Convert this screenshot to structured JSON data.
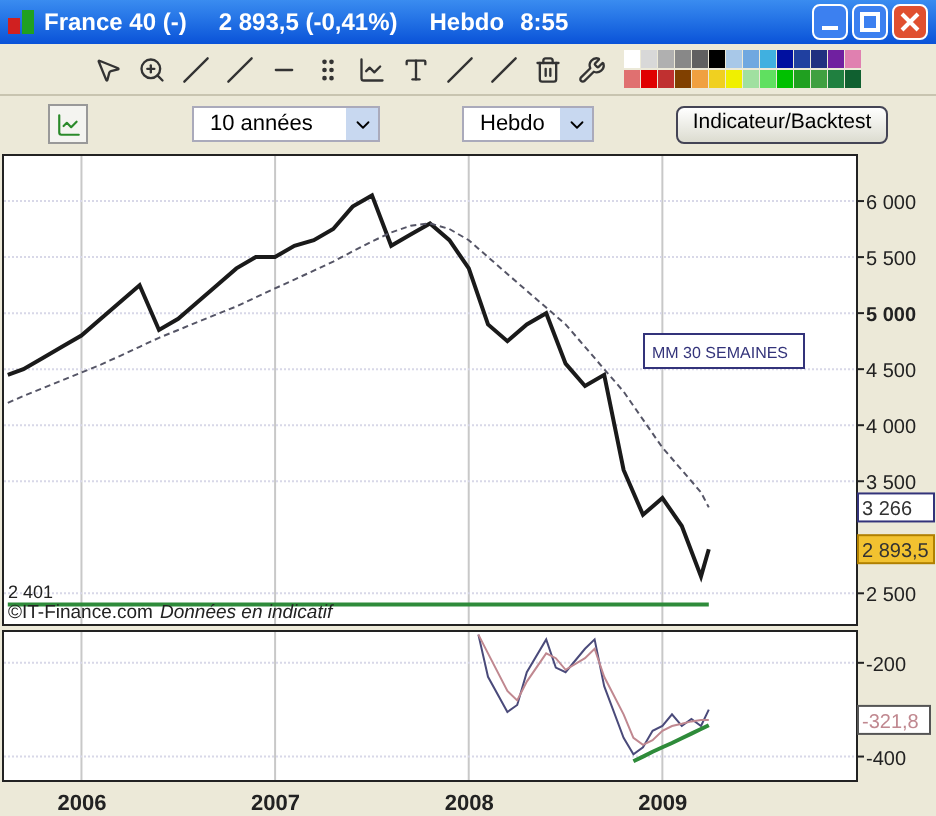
{
  "window": {
    "title_name": "France 40 (-)",
    "title_price": "2 893,5 (-0,41%)",
    "title_period": "Hebdo",
    "title_time": "8:55"
  },
  "toolbar2": {
    "range_select": "10 années",
    "period_select": "Hebdo",
    "indicator_button": "Indicateur/Backtest"
  },
  "price_chart": {
    "source": "©IT-Finance.com",
    "disclaimer": "Données en indicatif",
    "level_label": "2 401",
    "value_tags": [
      {
        "text": "3 266",
        "color": "#ffffff"
      },
      {
        "text": "2 893,5",
        "color": "#f2c230"
      }
    ],
    "chart_data": {
      "type": "line",
      "grid": true,
      "x": [
        2005.62,
        2005.7,
        2005.8,
        2005.9,
        2006.0,
        2006.1,
        2006.2,
        2006.3,
        2006.4,
        2006.5,
        2006.6,
        2006.7,
        2006.8,
        2006.9,
        2007.0,
        2007.1,
        2007.2,
        2007.3,
        2007.4,
        2007.5,
        2007.6,
        2007.7,
        2007.8,
        2007.9,
        2008.0,
        2008.1,
        2008.2,
        2008.3,
        2008.4,
        2008.5,
        2008.6,
        2008.7,
        2008.8,
        2008.9,
        2009.0,
        2009.1,
        2009.2,
        2009.24
      ],
      "series": [
        {
          "color": "#1a1a1a",
          "values": [
            4450,
            4500,
            4600,
            4700,
            4800,
            4950,
            5100,
            5250,
            4850,
            4950,
            5100,
            5250,
            5400,
            5500,
            5500,
            5600,
            5650,
            5750,
            5950,
            6050,
            5600,
            5700,
            5800,
            5650,
            5400,
            4900,
            4750,
            4900,
            5000,
            4550,
            4350,
            4450,
            3600,
            3200,
            3350,
            3100,
            2650,
            2893.5
          ]
        },
        {
          "color": "#555566",
          "line_style": "dashed",
          "values": [
            4200,
            4260,
            4330,
            4400,
            4470,
            4540,
            4620,
            4700,
            4780,
            4850,
            4920,
            4990,
            5060,
            5140,
            5220,
            5300,
            5380,
            5460,
            5550,
            5640,
            5720,
            5780,
            5800,
            5750,
            5650,
            5500,
            5350,
            5200,
            5050,
            4900,
            4700,
            4500,
            4300,
            4050,
            3800,
            3600,
            3400,
            3266
          ]
        },
        {
          "color": "#2e8b3a",
          "values": [
            2401,
            2401,
            2401,
            2401,
            2401,
            2401,
            2401,
            2401,
            2401,
            2401,
            2401,
            2401,
            2401,
            2401,
            2401,
            2401,
            2401,
            2401,
            2401,
            2401,
            2401,
            2401,
            2401,
            2401,
            2401,
            2401,
            2401,
            2401,
            2401,
            2401,
            2401,
            2401,
            2401,
            2401,
            2401,
            2401,
            2401,
            2401
          ]
        }
      ],
      "xlim": [
        2005.6,
        2010.0
      ],
      "ylim": [
        2226,
        6420
      ],
      "yticks": [
        {
          "value": 2500,
          "label": "2 500"
        },
        {
          "value": 3500,
          "label": "3 500"
        },
        {
          "value": 4000,
          "label": "4 000"
        },
        {
          "value": 4500,
          "label": "4 500"
        },
        {
          "value": 5000,
          "label": "5 000"
        },
        {
          "value": 5500,
          "label": "5 500"
        },
        {
          "value": 6000,
          "label": "6 000"
        }
      ],
      "annotations": [
        "MM 30 SEMAINES"
      ]
    }
  },
  "oscillator": {
    "value_tags": [
      {
        "text": "-321,8",
        "color": "#c08890"
      }
    ],
    "chart_data": {
      "type": "line",
      "grid": true,
      "x": [
        2008.05,
        2008.1,
        2008.2,
        2008.25,
        2008.3,
        2008.4,
        2008.45,
        2008.5,
        2008.6,
        2008.65,
        2008.7,
        2008.8,
        2008.85,
        2008.9,
        2008.95,
        2009.0,
        2009.05,
        2009.1,
        2009.15,
        2009.2,
        2009.24
      ],
      "series": [
        {
          "color": "#4a4a7a",
          "values": [
            -140,
            -230,
            -305,
            -290,
            -220,
            -150,
            -210,
            -220,
            -170,
            -150,
            -250,
            -360,
            -395,
            -380,
            -345,
            -335,
            -310,
            -335,
            -320,
            -335,
            -300
          ]
        },
        {
          "color": "#c08890",
          "values": [
            -140,
            -180,
            -260,
            -280,
            -240,
            -180,
            -190,
            -215,
            -190,
            -170,
            -230,
            -310,
            -360,
            -375,
            -365,
            -345,
            -335,
            -330,
            -325,
            -322,
            -321.8
          ]
        },
        {
          "color": "#2e8b3a",
          "values": [
            null,
            null,
            null,
            null,
            null,
            null,
            null,
            null,
            null,
            null,
            null,
            null,
            -410,
            -400,
            -390,
            -380,
            -371,
            -361,
            -351,
            -341,
            -333
          ]
        }
      ],
      "xlim": [
        2005.6,
        2010.0
      ],
      "ylim": [
        -450,
        -130
      ],
      "xticks": [
        2006,
        2007,
        2008,
        2009
      ],
      "yticks": [
        {
          "value": -200,
          "label": "-200"
        },
        {
          "value": -400,
          "label": "-400"
        }
      ]
    }
  }
}
